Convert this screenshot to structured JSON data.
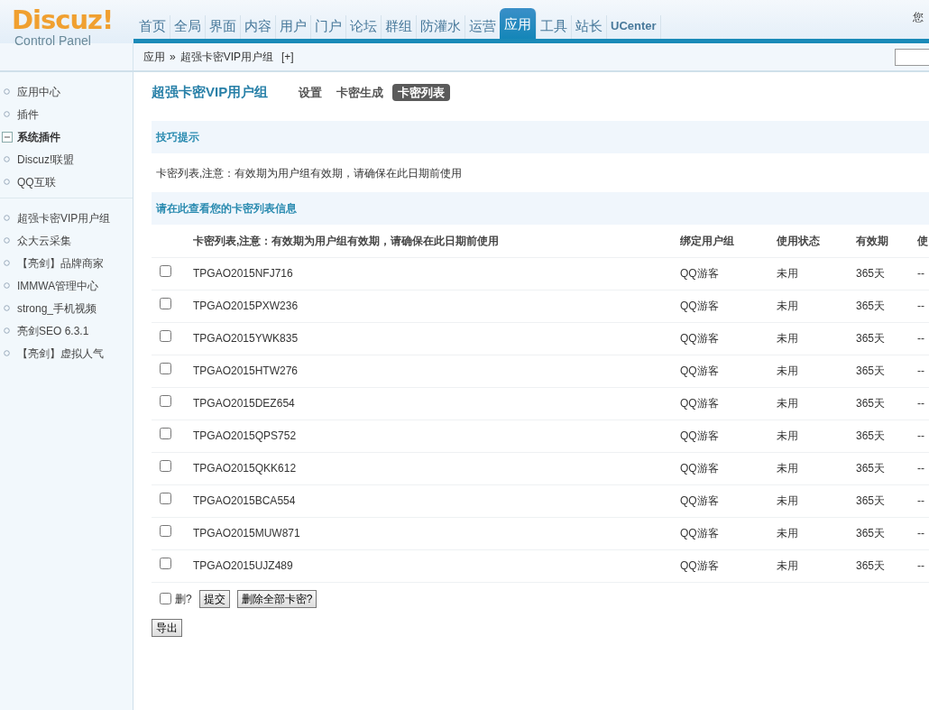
{
  "logo": {
    "title": "Discuz!",
    "subtitle": "Control Panel"
  },
  "nav": [
    {
      "label": "首页",
      "selected": false
    },
    {
      "label": "全局",
      "selected": false
    },
    {
      "label": "界面",
      "selected": false
    },
    {
      "label": "内容",
      "selected": false
    },
    {
      "label": "用户",
      "selected": false
    },
    {
      "label": "门户",
      "selected": false
    },
    {
      "label": "论坛",
      "selected": false
    },
    {
      "label": "群组",
      "selected": false
    },
    {
      "label": "防灌水",
      "selected": false
    },
    {
      "label": "运营",
      "selected": false
    },
    {
      "label": "应用",
      "selected": true
    },
    {
      "label": "工具",
      "selected": false
    },
    {
      "label": "站长",
      "selected": false
    },
    {
      "label": "UCenter",
      "selected": false
    }
  ],
  "greeting": "您",
  "breadcrumb": {
    "items": [
      "应用",
      "超强卡密VIP用户组"
    ],
    "separator": "»",
    "toggle": "[+]"
  },
  "sidebar": {
    "sections": [
      {
        "items": [
          {
            "kind": "link",
            "label": "应用中心"
          },
          {
            "kind": "link",
            "label": "插件"
          },
          {
            "kind": "group",
            "label": "系统插件",
            "expanded": true
          },
          {
            "kind": "link",
            "label": "Discuz!联盟"
          },
          {
            "kind": "link",
            "label": "QQ互联"
          }
        ]
      },
      {
        "items": [
          {
            "kind": "link",
            "label": "超强卡密VIP用户组"
          },
          {
            "kind": "link",
            "label": "众大云采集"
          },
          {
            "kind": "link",
            "label": "【亮剑】品牌商家"
          },
          {
            "kind": "link",
            "label": "IMMWA管理中心"
          },
          {
            "kind": "link",
            "label": "strong_手机视频"
          },
          {
            "kind": "link",
            "label": "亮剑SEO 6.3.1"
          },
          {
            "kind": "link",
            "label": "【亮剑】虚拟人气"
          }
        ]
      }
    ]
  },
  "page": {
    "title": "超强卡密VIP用户组",
    "tabs": [
      {
        "label": "设置",
        "selected": false
      },
      {
        "label": "卡密生成",
        "selected": false
      },
      {
        "label": "卡密列表",
        "selected": true
      }
    ]
  },
  "tips": {
    "title": "技巧提示",
    "text": "卡密列表,注意：有效期为用户组有效期，请确保在此日期前使用"
  },
  "table": {
    "title": "请在此查看您的卡密列表信息",
    "columns": [
      "卡密列表,注意：有效期为用户组有效期，请确保在此日期前使用",
      "绑定用户组",
      "使用状态",
      "有效期",
      "使"
    ],
    "rows": [
      {
        "checked": false,
        "cells": [
          "TPGAO2015NFJ716",
          "QQ游客",
          "未用",
          "365天",
          "--"
        ]
      },
      {
        "checked": false,
        "cells": [
          "TPGAO2015PXW236",
          "QQ游客",
          "未用",
          "365天",
          "--"
        ]
      },
      {
        "checked": false,
        "cells": [
          "TPGAO2015YWK835",
          "QQ游客",
          "未用",
          "365天",
          "--"
        ]
      },
      {
        "checked": false,
        "cells": [
          "TPGAO2015HTW276",
          "QQ游客",
          "未用",
          "365天",
          "--"
        ]
      },
      {
        "checked": false,
        "cells": [
          "TPGAO2015DEZ654",
          "QQ游客",
          "未用",
          "365天",
          "--"
        ]
      },
      {
        "checked": false,
        "cells": [
          "TPGAO2015QPS752",
          "QQ游客",
          "未用",
          "365天",
          "--"
        ]
      },
      {
        "checked": false,
        "cells": [
          "TPGAO2015QKK612",
          "QQ游客",
          "未用",
          "365天",
          "--"
        ]
      },
      {
        "checked": false,
        "cells": [
          "TPGAO2015BCA554",
          "QQ游客",
          "未用",
          "365天",
          "--"
        ]
      },
      {
        "checked": false,
        "cells": [
          "TPGAO2015MUW871",
          "QQ游客",
          "未用",
          "365天",
          "--"
        ]
      },
      {
        "checked": false,
        "cells": [
          "TPGAO2015UJZ489",
          "QQ游客",
          "未用",
          "365天",
          "--"
        ]
      }
    ]
  },
  "footer": {
    "delete_label": "删?",
    "delete_checked": false,
    "buttons": [
      "提交",
      "删除全部卡密?"
    ],
    "export": "导出"
  }
}
